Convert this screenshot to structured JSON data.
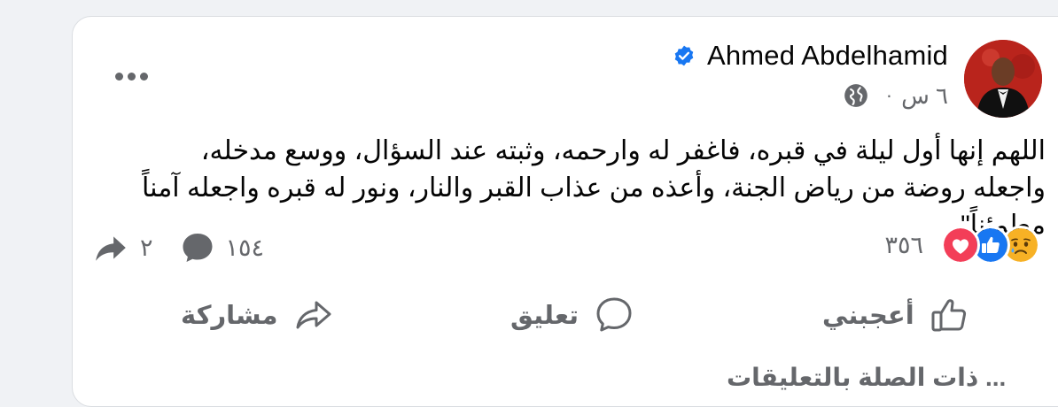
{
  "post": {
    "author": "Ahmed Abdelhamid",
    "time": "٦ س",
    "separator": "·",
    "text": "اللهم إنها أول ليلة في قبره، فاغفر له وارحمه، وثبته عند السؤال، ووسع مدخله، واجعله روضة من رياض الجنة، وأعذه من عذاب القبر والنار، ونور له قبره واجعله آمناً مطمئناً\".",
    "reaction_count": "٣٥٦",
    "comment_count": "١٥٤",
    "share_count": "٢",
    "reactions": [
      "sad-reaction",
      "like-reaction",
      "love-reaction"
    ]
  },
  "actions": {
    "like": "أعجبني",
    "comment": "تعليق",
    "share": "مشاركة"
  },
  "bottom": {
    "partial_text": "... ذات الصلة بالتعليقات"
  },
  "colors": {
    "brand_blue": "#1877f2",
    "love_red": "#f33e58",
    "sad_yellow": "#f7b125",
    "secondary_text": "#65676b"
  }
}
